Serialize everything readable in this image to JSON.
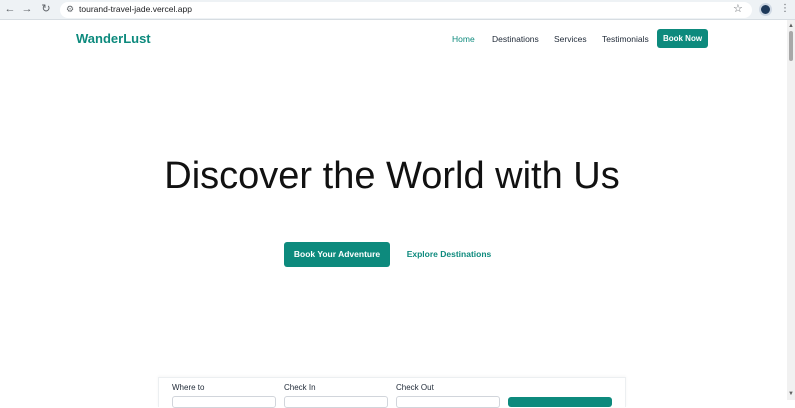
{
  "browser": {
    "url": "tourand-travel-jade.vercel.app",
    "back_icon": "←",
    "forward_icon": "→",
    "reload_icon": "↻",
    "site_icon": "⚙",
    "star_icon": "☆",
    "menu_icon": "⋮"
  },
  "site": {
    "logo": "WanderLust",
    "nav": {
      "home": "Home",
      "destinations": "Destinations",
      "services": "Services",
      "testimonials": "Testimonials"
    },
    "book_now": "Book Now"
  },
  "hero": {
    "title": "Discover the World with Us",
    "primary_button": "Book Your Adventure",
    "secondary_link": "Explore Destinations"
  },
  "search": {
    "where_label": "Where to",
    "checkin_label": "Check In",
    "checkout_label": "Check Out"
  },
  "colors": {
    "brand": "#0d8a7d",
    "text": "#111111"
  }
}
